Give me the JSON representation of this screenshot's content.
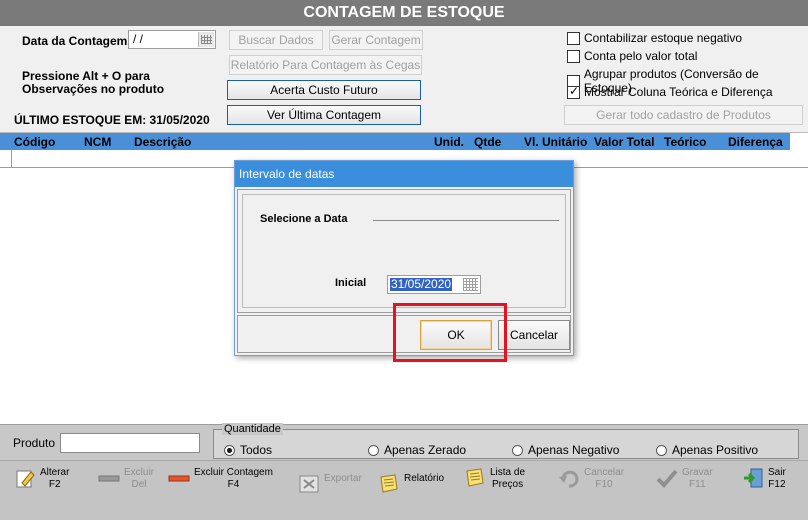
{
  "window": {
    "title": "CONTAGEM DE ESTOQUE"
  },
  "header": {
    "date_label": "Data da Contagem:",
    "date_value": "/ /",
    "hint_line1": "Pressione Alt + O para",
    "hint_line2": "Observações no produto",
    "last_stock": "ÚLTIMO ESTOQUE EM: 31/05/2020",
    "buttons": {
      "buscar": "Buscar Dados",
      "gerar": "Gerar Contagem",
      "relatorio": "Relatório Para Contagem às Cegas",
      "acerta": "Acerta Custo Futuro",
      "ver": "Ver Última Contagem",
      "gerar_todo": "Gerar todo cadastro de Produtos"
    },
    "checkboxes": [
      {
        "label": "Contabilizar estoque negativo",
        "checked": false
      },
      {
        "label": "Conta pelo valor total",
        "checked": false
      },
      {
        "label": "Agrupar produtos (Conversão de Estoque)",
        "checked": false
      },
      {
        "label": "Mostrar Coluna Teórica e Diferença",
        "checked": true
      }
    ]
  },
  "grid": {
    "columns": [
      "Código",
      "NCM",
      "Descrição",
      "Unid.",
      "Qtde",
      "Vl. Unitário",
      "Valor Total",
      "Teórico",
      "Diferença"
    ]
  },
  "filter": {
    "produto_label": "Produto",
    "produto_value": "",
    "quantidade_label": "Quantidade",
    "options": [
      "Todos",
      "Apenas Zerado",
      "Apenas Negativo",
      "Apenas Positivo"
    ],
    "selected": "Todos"
  },
  "toolbar": [
    {
      "line1": "Alterar",
      "line2": "F2",
      "icon": "edit-icon",
      "enabled": true
    },
    {
      "line1": "Excluir",
      "line2": "Del",
      "icon": "delete-icon",
      "enabled": false
    },
    {
      "line1": "Excluir Contagem",
      "line2": "F4",
      "icon": "delete-count-icon",
      "enabled": true
    },
    {
      "line1": "Exportar",
      "line2": "",
      "icon": "export-icon",
      "enabled": false
    },
    {
      "line1": "Relatório",
      "line2": "",
      "icon": "report-icon",
      "enabled": true
    },
    {
      "line1": "Lista de",
      "line2": "Preços",
      "icon": "price-list-icon",
      "enabled": true
    },
    {
      "line1": "Cancelar",
      "line2": "F10",
      "icon": "undo-icon",
      "enabled": false
    },
    {
      "line1": "Gravar",
      "line2": "F11",
      "icon": "check-icon",
      "enabled": false
    },
    {
      "line1": "Sair",
      "line2": "F12",
      "icon": "exit-icon",
      "enabled": true
    }
  ],
  "dialog": {
    "title": "Intervalo de datas",
    "group_label": "Selecione a Data",
    "initial_label": "Inicial",
    "initial_value": "31/05/2020",
    "ok_label": "OK",
    "cancel_label": "Cancelar"
  },
  "colors": {
    "title_bar": "#7a7a7a",
    "grid_header": "#4a90d9",
    "dialog_title": "#3b8edb",
    "highlight": "#e5121f"
  }
}
